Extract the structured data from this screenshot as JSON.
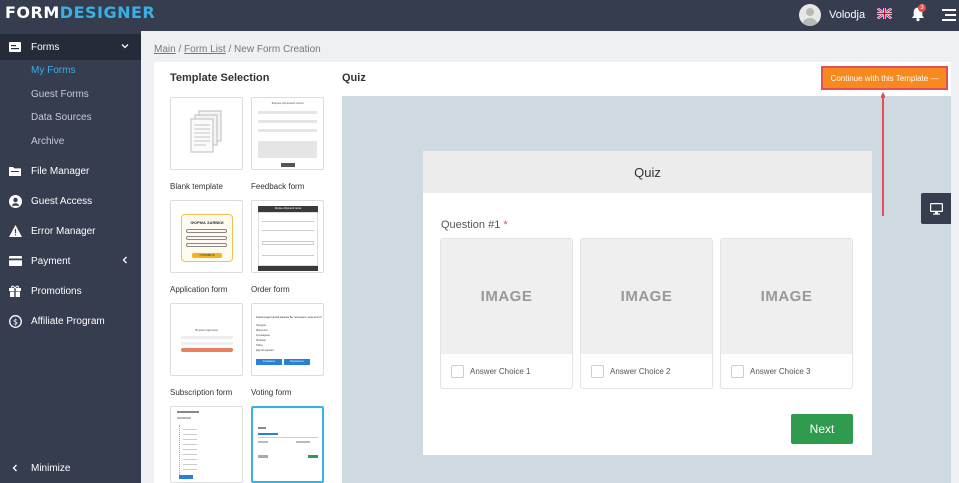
{
  "app": {
    "logo_part1": "FORM",
    "logo_part2": "DESIGNER"
  },
  "topbar": {
    "user_name": "Volodja",
    "notification_count": "3",
    "flag_icon": "uk-flag-icon"
  },
  "sidebar": {
    "items": [
      {
        "label": "Forms",
        "icon": "form-icon"
      },
      {
        "label": "File Manager",
        "icon": "folder-icon"
      },
      {
        "label": "Guest Access",
        "icon": "user-circle-icon"
      },
      {
        "label": "Error Manager",
        "icon": "warning-icon"
      },
      {
        "label": "Payment",
        "icon": "card-icon"
      },
      {
        "label": "Promotions",
        "icon": "gift-icon"
      },
      {
        "label": "Affiliate Program",
        "icon": "dollar-icon"
      }
    ],
    "sub_items": [
      "My Forms",
      "Guest Forms",
      "Data Sources",
      "Archive"
    ],
    "minimize_label": "Minimize"
  },
  "breadcrumb": {
    "main": "Main",
    "form_list": "Form List",
    "current": "New Form Creation",
    "sep": "/"
  },
  "template_selection": {
    "title": "Template Selection",
    "templates": [
      {
        "name": "Blank template"
      },
      {
        "name": "Feedback form"
      },
      {
        "name": "Application form"
      },
      {
        "name": "Order form"
      },
      {
        "name": "Subscription form"
      },
      {
        "name": "Voting form"
      }
    ],
    "mini": {
      "feedback_title": "Форма обратной связи",
      "application_title": "ФОРМА ЗАЯВКИ",
      "application_button": "ОТПРАВИТЬ",
      "order_title": "Форма обратной связи",
      "subscribe_title": "Форма подписки",
      "voting_question": "Какой кондитерский магазин Вы посещаете чаще всего?",
      "voting_options": [
        "Пекарня",
        "Магнолия",
        "Кулинарная",
        "Shokolat",
        "Toffee"
      ],
      "voting_other": "Другой вариант",
      "voting_btn1": "Отправить",
      "voting_btn2": "Результаты"
    }
  },
  "preview": {
    "label": "Quiz",
    "continue_button": "Continue with this Template —",
    "quiz_title": "Quiz",
    "question_label": "Question #1",
    "required_mark": "*",
    "choices": [
      {
        "image_text": "IMAGE",
        "label": "Answer Choice 1"
      },
      {
        "image_text": "IMAGE",
        "label": "Answer Choice 2"
      },
      {
        "image_text": "IMAGE",
        "label": "Answer Choice 3"
      }
    ],
    "next_button": "Next"
  },
  "colors": {
    "sidebar": "#363d4f",
    "accent": "#39b0e6",
    "orange": "#f7891f",
    "green": "#2f9b4e"
  }
}
